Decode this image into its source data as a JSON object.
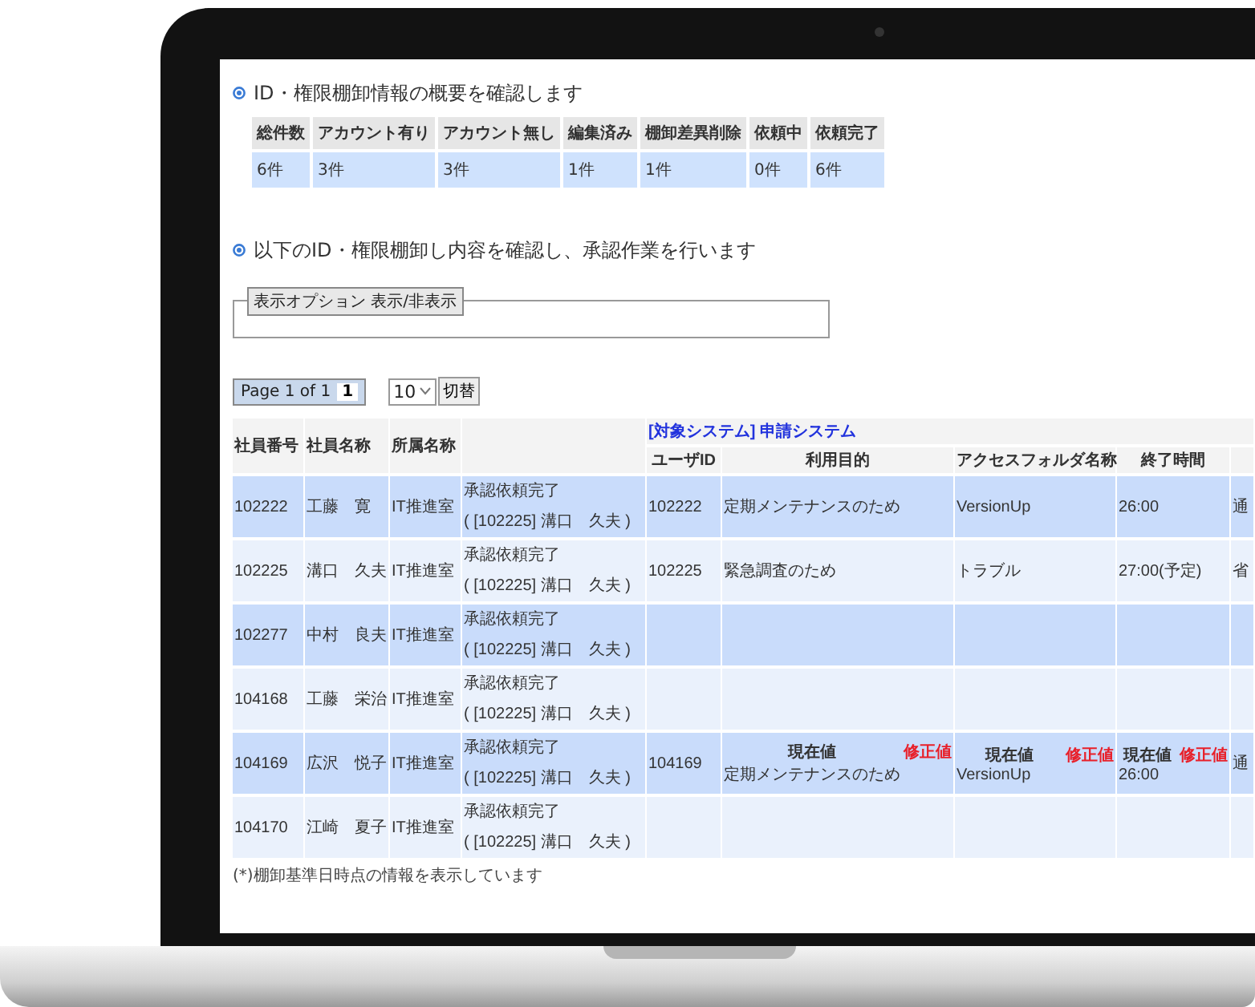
{
  "summary": {
    "heading": "ID・権限棚卸情報の概要を確認します",
    "columns": [
      "総件数",
      "アカウント有り",
      "アカウント無し",
      "編集済み",
      "棚卸差異削除",
      "依頼中",
      "依頼完了"
    ],
    "values": [
      "6件",
      "3件",
      "3件",
      "1件",
      "1件",
      "0件",
      "6件"
    ]
  },
  "section_heading": "以下のID・権限棚卸し内容を確認し、承認作業を行います",
  "options_toggle": "表示オプション 表示/非表示",
  "pager": {
    "label": "Page 1 of 1",
    "current_page": "1",
    "page_size": "10",
    "apply_button": "切替"
  },
  "table": {
    "columns_left": [
      "社員番号",
      "社員名称",
      "所属名称"
    ],
    "system_caption": "[対象システム] 申請システム",
    "columns_right": [
      "ユーザID",
      "利用目的",
      "アクセスフォルダ名称",
      "終了時間"
    ],
    "rows": [
      {
        "kind": "plain",
        "employee_id": "102222",
        "name": "工藤　寛",
        "department": "IT推進室",
        "status": "承認依頼完了",
        "approver": "( [102225] 溝口　久夫 )",
        "user_id": "102222",
        "purpose": "定期メンテナンスのため",
        "folder": "VersionUp",
        "end_time": "26:00",
        "column_9": "通"
      },
      {
        "kind": "plain",
        "employee_id": "102225",
        "name": "溝口　久夫",
        "department": "IT推進室",
        "status": "承認依頼完了",
        "approver": "( [102225] 溝口　久夫 )",
        "user_id": "102225",
        "purpose": "緊急調査のため",
        "folder": "トラブル",
        "end_time": "27:00(予定)",
        "column_9": "省"
      },
      {
        "kind": "plain",
        "employee_id": "102277",
        "name": "中村　良夫",
        "department": "IT推進室",
        "status": "承認依頼完了",
        "approver": "( [102225] 溝口　久夫 )"
      },
      {
        "kind": "plain",
        "employee_id": "104168",
        "name": "工藤　栄治",
        "department": "IT推進室",
        "status": "承認依頼完了",
        "approver": "( [102225] 溝口　久夫 )"
      },
      {
        "kind": "compare",
        "employee_id": "104169",
        "name": "広沢　悦子",
        "department": "IT推進室",
        "status": "承認依頼完了",
        "approver": "( [102225] 溝口　久夫 )",
        "user_id": "104169",
        "purpose": {
          "current_label": "現在値",
          "corrected_label": "修正値",
          "current": "定期メンテナンスのため"
        },
        "folder": {
          "current_label": "現在値",
          "corrected_label": "修正値",
          "current": "VersionUp"
        },
        "end_time": {
          "current_label": "現在値",
          "corrected_label": "修正値",
          "current": "26:00"
        },
        "column_9": "通"
      },
      {
        "kind": "plain",
        "employee_id": "104170",
        "name": "江崎　夏子",
        "department": "IT推進室",
        "status": "承認依頼完了",
        "approver": "( [102225] 溝口　久夫 )"
      }
    ]
  },
  "footnote": "(*)棚卸基準日時点の情報を表示しています"
}
